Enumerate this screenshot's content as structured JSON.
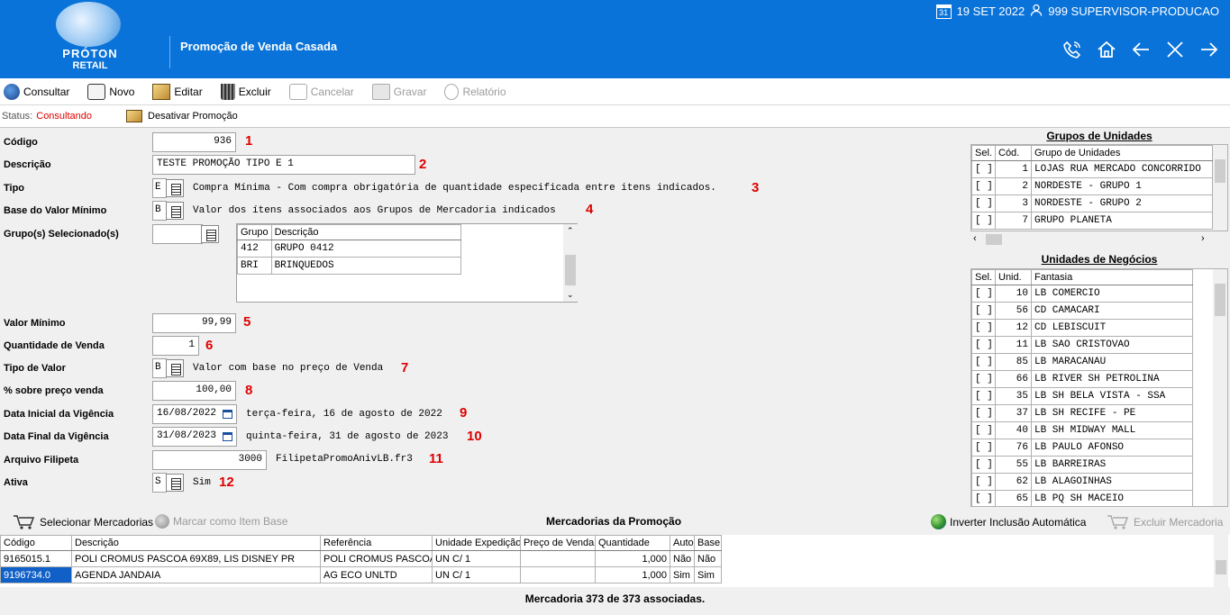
{
  "header": {
    "brand": "PRÓTON",
    "brand_sub": "RETAIL",
    "page_title": "Promoção de Venda Casada",
    "date": "19 SET 2022",
    "calendar_day": "31",
    "user": "999 SUPERVISOR-PRODUCAO"
  },
  "toolbar": {
    "consultar": "Consultar",
    "novo": "Novo",
    "editar": "Editar",
    "excluir": "Excluir",
    "cancelar": "Cancelar",
    "gravar": "Gravar",
    "relatorio": "Relatório"
  },
  "status": {
    "label": "Status:",
    "value": "Consultando",
    "desativar": "Desativar Promoção"
  },
  "form": {
    "codigo_label": "Código",
    "codigo": "936",
    "descricao_label": "Descrição",
    "descricao": "TESTE PROMOÇÃO TIPO E 1",
    "tipo_label": "Tipo",
    "tipo": "E",
    "tipo_desc": "Compra Mínima - Com compra obrigatória de quantidade especificada entre itens indicados.",
    "base_label": "Base do Valor Mínimo",
    "base": "B",
    "base_desc": "Valor dos ítens associados aos Grupos de Mercadoria indicados",
    "grupos_label": "Grupo(s) Selecionado(s)",
    "grupos_input": "",
    "grupos_headers": [
      "Grupo",
      "Descrição"
    ],
    "grupos_rows": [
      [
        "412",
        "GRUPO 0412"
      ],
      [
        "BRI",
        "BRINQUEDOS"
      ]
    ],
    "valor_min_label": "Valor Mínimo",
    "valor_min": "99,99",
    "qtd_label": "Quantidade de Venda",
    "qtd": "1",
    "tipo_valor_label": "Tipo de Valor",
    "tipo_valor": "B",
    "tipo_valor_desc": "Valor com base no preço de Venda",
    "perc_label": "% sobre preço venda",
    "perc": "100,00",
    "data_ini_label": "Data Inicial da Vigência",
    "data_ini": "16/08/2022",
    "data_ini_desc": "terça-feira, 16 de agosto de 2022",
    "data_fim_label": "Data Final da Vigência",
    "data_fim": "31/08/2023",
    "data_fim_desc": "quinta-feira, 31 de agosto de 2023",
    "filipeta_label": "Arquivo Filipeta",
    "filipeta": "3000",
    "filipeta_desc": "FilipetaPromoAnivLB.fr3",
    "ativa_label": "Ativa",
    "ativa": "S",
    "ativa_desc": "Sim",
    "markers": [
      "1",
      "2",
      "3",
      "4",
      "5",
      "6",
      "7",
      "8",
      "9",
      "10",
      "11",
      "12"
    ]
  },
  "grupos_unidades": {
    "title": "Grupos de Unidades",
    "headers": [
      "Sel.",
      "Cód.",
      "Grupo de Unidades"
    ],
    "rows": [
      [
        "[ ]",
        "1",
        "LOJAS RUA MERCADO CONCORRIDO"
      ],
      [
        "[ ]",
        "2",
        "NORDESTE - GRUPO 1"
      ],
      [
        "[ ]",
        "3",
        "NORDESTE - GRUPO 2"
      ],
      [
        "[ ]",
        "7",
        "GRUPO PLANETA"
      ]
    ]
  },
  "unidades_negocios": {
    "title": "Unidades de Negócios",
    "headers": [
      "Sel.",
      "Unid.",
      "Fantasia"
    ],
    "rows": [
      [
        "[ ]",
        "10",
        "LB COMERCIO"
      ],
      [
        "[ ]",
        "56",
        "CD CAMACARI"
      ],
      [
        "[ ]",
        "12",
        "CD LEBISCUIT"
      ],
      [
        "[ ]",
        "11",
        "LB SAO CRISTOVAO"
      ],
      [
        "[ ]",
        "85",
        "LB MARACANAU"
      ],
      [
        "[ ]",
        "66",
        "LB RIVER SH PETROLINA"
      ],
      [
        "[ ]",
        "35",
        "LB SH BELA VISTA - SSA"
      ],
      [
        "[ ]",
        "37",
        "LB SH RECIFE - PE"
      ],
      [
        "[ ]",
        "40",
        "LB SH MIDWAY MALL"
      ],
      [
        "[ ]",
        "76",
        "LB PAULO AFONSO"
      ],
      [
        "[ ]",
        "55",
        "LB BARREIRAS"
      ],
      [
        "[ ]",
        "62",
        "LB ALAGOINHAS"
      ],
      [
        "[ ]",
        "65",
        "LB PQ SH MACEIO"
      ]
    ]
  },
  "mercadorias": {
    "selecionar": "Selecionar Mercadorias",
    "marcar": "Marcar como Item Base",
    "title": "Mercadorias da Promoção",
    "inverter": "Inverter Inclusão Automática",
    "excluir": "Excluir Mercadoria",
    "headers": [
      "Código",
      "Descrição",
      "Referência",
      "Unidade Expedição",
      "Preço de Venda",
      "Quantidade",
      "Auto",
      "Base"
    ],
    "rows": [
      [
        "9165015.1",
        "POLI CROMUS PASCOA 69X89, LIS DISNEY PR",
        "POLI CROMUS PASCOA",
        "UN C/ 1",
        "",
        "1,000",
        "Não",
        "Não"
      ],
      [
        "9196734.0",
        "AGENDA JANDAIA",
        "AG ECO UNLTD",
        "UN C/ 1",
        "",
        "1,000",
        "Sim",
        "Sim"
      ]
    ],
    "footer": "Mercadoria 373 de 373 associadas."
  },
  "colors": {
    "header_bg": "#0a73d9",
    "status_red": "#e00000",
    "selected_row": "#1060c8"
  }
}
